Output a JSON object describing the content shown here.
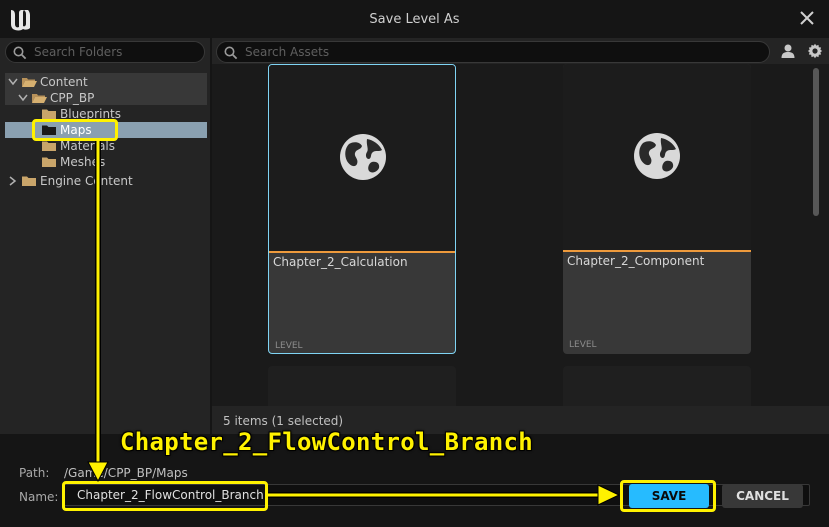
{
  "window": {
    "title": "Save Level As"
  },
  "folders": {
    "search_placeholder": "Search Folders",
    "tree": [
      {
        "label": "Content",
        "expanded": true,
        "depth": 0
      },
      {
        "label": "CPP_BP",
        "expanded": true,
        "depth": 1
      },
      {
        "label": "Blueprints",
        "depth": 2
      },
      {
        "label": "Maps",
        "depth": 2,
        "selected": true
      },
      {
        "label": "Materials",
        "depth": 2
      },
      {
        "label": "Meshes",
        "depth": 2
      },
      {
        "label": "Engine Content",
        "expanded": false,
        "depth": 0
      }
    ]
  },
  "assets": {
    "search_placeholder": "Search Assets",
    "tiles": [
      {
        "name": "Chapter_2_Calculation",
        "type": "LEVEL",
        "selected": true
      },
      {
        "name": "Chapter_2_Component",
        "type": "LEVEL",
        "selected": false
      }
    ],
    "status": "5 items (1 selected)"
  },
  "form": {
    "path_label": "Path:",
    "path_value": "/Game/CPP_BP/Maps",
    "name_label": "Name:",
    "name_value": "Chapter_2_FlowControl_Branch"
  },
  "buttons": {
    "save": "SAVE",
    "cancel": "CANCEL"
  },
  "annotation": {
    "text": "Chapter_2_FlowControl_Branch",
    "color": "#fff200"
  },
  "colors": {
    "accent": "#26bbff",
    "selection_outline": "#7fd4f4",
    "level_bar": "#ee9a3c",
    "folder": "#c9a56a"
  }
}
